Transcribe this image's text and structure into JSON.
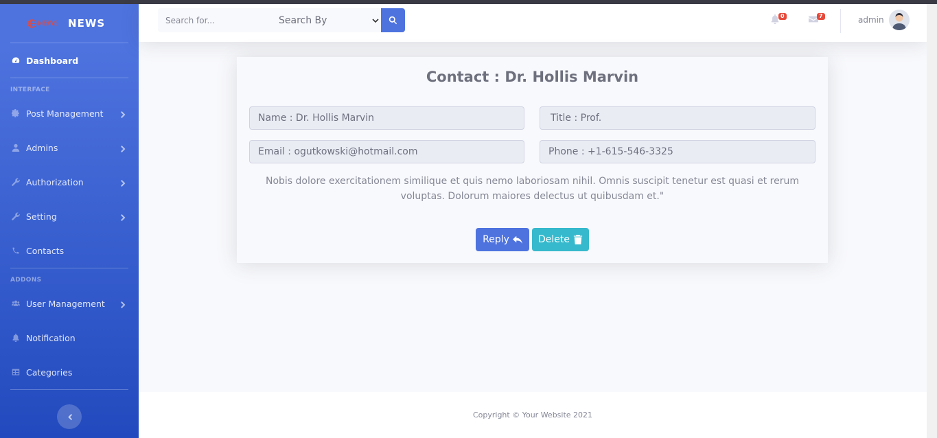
{
  "brand": {
    "logo_text": "NEWS",
    "title": "NEWS"
  },
  "sidebar": {
    "dashboard": "Dashboard",
    "heading_interface": "INTERFACE",
    "post_management": "Post Management",
    "admins": "Admins",
    "authorization": "Authorization",
    "setting": "Setting",
    "contacts": "Contacts",
    "heading_addons": "ADDONS",
    "user_management": "User Management",
    "notification": "Notification",
    "categories": "Categories"
  },
  "search": {
    "placeholder": "Search for...",
    "select_value": "Search By"
  },
  "topbar": {
    "alerts_count": "0",
    "messages_count": "7",
    "user_name": "admin"
  },
  "contact": {
    "title": "Contact : Dr. Hollis Marvin",
    "name": "Name : Dr. Hollis Marvin",
    "title_field": "Title : Prof.",
    "email": "Email : ogutkowski@hotmail.com",
    "phone": "Phone : +1-615-546-3325",
    "message": "Nobis dolore exercitationem similique et quis nemo laboriosam nihil. Omnis suscipit tenetur est quasi et rerum voluptas. Dolorum maiores delectus ut quibusdam et.\"",
    "reply_label": "Reply",
    "delete_label": "Delete"
  },
  "footer": {
    "copyright": "Copyright © Your Website 2021"
  },
  "colors": {
    "primary": "#4e73df",
    "info": "#36b9cc",
    "danger": "#e74a3b"
  }
}
